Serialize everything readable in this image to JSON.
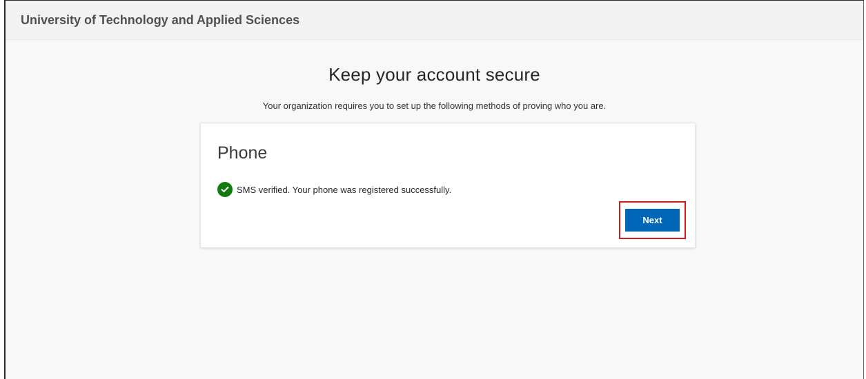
{
  "header": {
    "org_name": "University of Technology and Applied Sciences"
  },
  "main": {
    "title": "Keep your account secure",
    "subtitle": "Your organization requires you to set up the following methods of proving who you are."
  },
  "card": {
    "title": "Phone",
    "status_icon": "check-circle-icon",
    "status_text": "SMS verified. Your phone was registered successfully.",
    "next_label": "Next"
  },
  "colors": {
    "accent": "#0067b8",
    "success": "#107c10",
    "highlight": "#d61a1a"
  }
}
